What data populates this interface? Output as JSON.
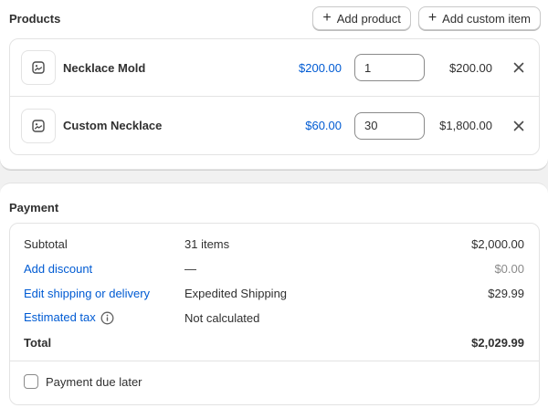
{
  "products": {
    "title": "Products",
    "add_product_label": "Add product",
    "add_custom_item_label": "Add custom item",
    "items": [
      {
        "name": "Necklace Mold",
        "unit_price": "$200.00",
        "quantity": "1",
        "total": "$200.00",
        "thumbnail_icon": "image-placeholder-icon",
        "remove_icon": "close-icon"
      },
      {
        "name": "Custom Necklace",
        "unit_price": "$60.00",
        "quantity": "30",
        "total": "$1,800.00",
        "thumbnail_icon": "image-placeholder-icon",
        "remove_icon": "close-icon"
      }
    ]
  },
  "payment": {
    "title": "Payment",
    "rows": [
      {
        "label": "Subtotal",
        "description": "31 items",
        "amount": "$2,000.00"
      },
      {
        "label": "Add discount",
        "description": "—",
        "amount": "$0.00"
      },
      {
        "label": "Edit shipping or delivery",
        "description": "Expedited Shipping",
        "amount": "$29.99"
      },
      {
        "label": "Estimated tax",
        "description": "Not calculated",
        "amount": "",
        "icon": "info-icon"
      },
      {
        "label": "Total",
        "description": "",
        "amount": "$2,029.99"
      }
    ],
    "payment_due_later_label": "Payment due later",
    "payment_due_later_checked": false
  },
  "colors": {
    "link": "#005bd3",
    "text": "#303030",
    "muted": "#8a8a8a",
    "border": "#e3e3e3",
    "page_background": "#f1f1f1"
  }
}
